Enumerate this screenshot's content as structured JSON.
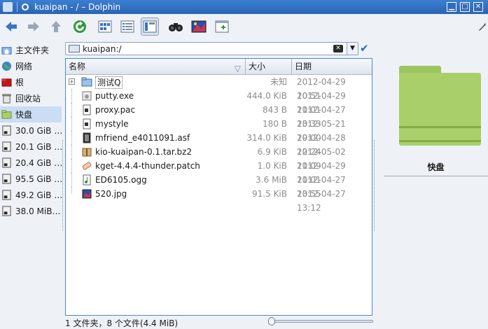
{
  "window": {
    "title": "kuaipan - / – Dolphin"
  },
  "location": {
    "path": "kuaipan:/"
  },
  "columns": {
    "name": "名称",
    "size": "大小",
    "date": "日期"
  },
  "sidebar": {
    "items": [
      {
        "label": "主文件夹",
        "icon": "home-folder-icon"
      },
      {
        "label": "网络",
        "icon": "network-globe-icon"
      },
      {
        "label": "根",
        "icon": "root-folder-icon"
      },
      {
        "label": "回收站",
        "icon": "trash-icon"
      },
      {
        "label": "快盘",
        "icon": "kuaipan-folder-icon",
        "selected": true
      },
      {
        "label": "30.0 GiB …",
        "icon": "drive-icon"
      },
      {
        "label": "20.1 GiB …",
        "icon": "drive-icon"
      },
      {
        "label": "20.4 GiB …",
        "icon": "drive-icon"
      },
      {
        "label": "95.5 GiB …",
        "icon": "drive-icon"
      },
      {
        "label": "49.2 GiB …",
        "icon": "drive-icon"
      },
      {
        "label": "38.0 MiB…",
        "icon": "drive-icon"
      }
    ]
  },
  "files": [
    {
      "name": "测试Q",
      "size": "未知",
      "date": "2012-04-29 10:51",
      "icon": "folder-icon"
    },
    {
      "name": "putty.exe",
      "size": "444.0 KiB",
      "date": "2012-04-29 11:01",
      "icon": "executable-icon"
    },
    {
      "name": "proxy.pac",
      "size": "843 B",
      "date": "2012-04-27 13:33",
      "icon": "text-file-icon"
    },
    {
      "name": "mystyle",
      "size": "180 B",
      "date": "2012-05-21 19:00",
      "icon": "text-file-icon"
    },
    {
      "name": "mfriend_e4011091.asf",
      "size": "314.0 KiB",
      "date": "2012-04-28 12:24",
      "icon": "video-file-icon"
    },
    {
      "name": "kio-kuaipan-0.1.tar.bz2",
      "size": "6.9 KiB",
      "date": "2012-05-02 11:09",
      "icon": "archive-icon"
    },
    {
      "name": "kget-4.4.4-thunder.patch",
      "size": "1.0 KiB",
      "date": "2012-04-29 11:01",
      "icon": "patch-file-icon"
    },
    {
      "name": "ED6105.ogg",
      "size": "3.6 MiB",
      "date": "2012-04-27 13:55",
      "icon": "audio-file-icon"
    },
    {
      "name": "520.jpg",
      "size": "91.5 KiB",
      "date": "2012-04-27 13:12",
      "icon": "image-file-icon"
    }
  ],
  "preview": {
    "name": "快盘"
  },
  "status": {
    "text": "1 文件夹，8 个文件(4.4 MiB)"
  },
  "zoom": {
    "level": 0
  },
  "colors": {
    "accent": "#2a64b4",
    "folder": "#a9cf6b",
    "selection": "#c9ddf4"
  }
}
